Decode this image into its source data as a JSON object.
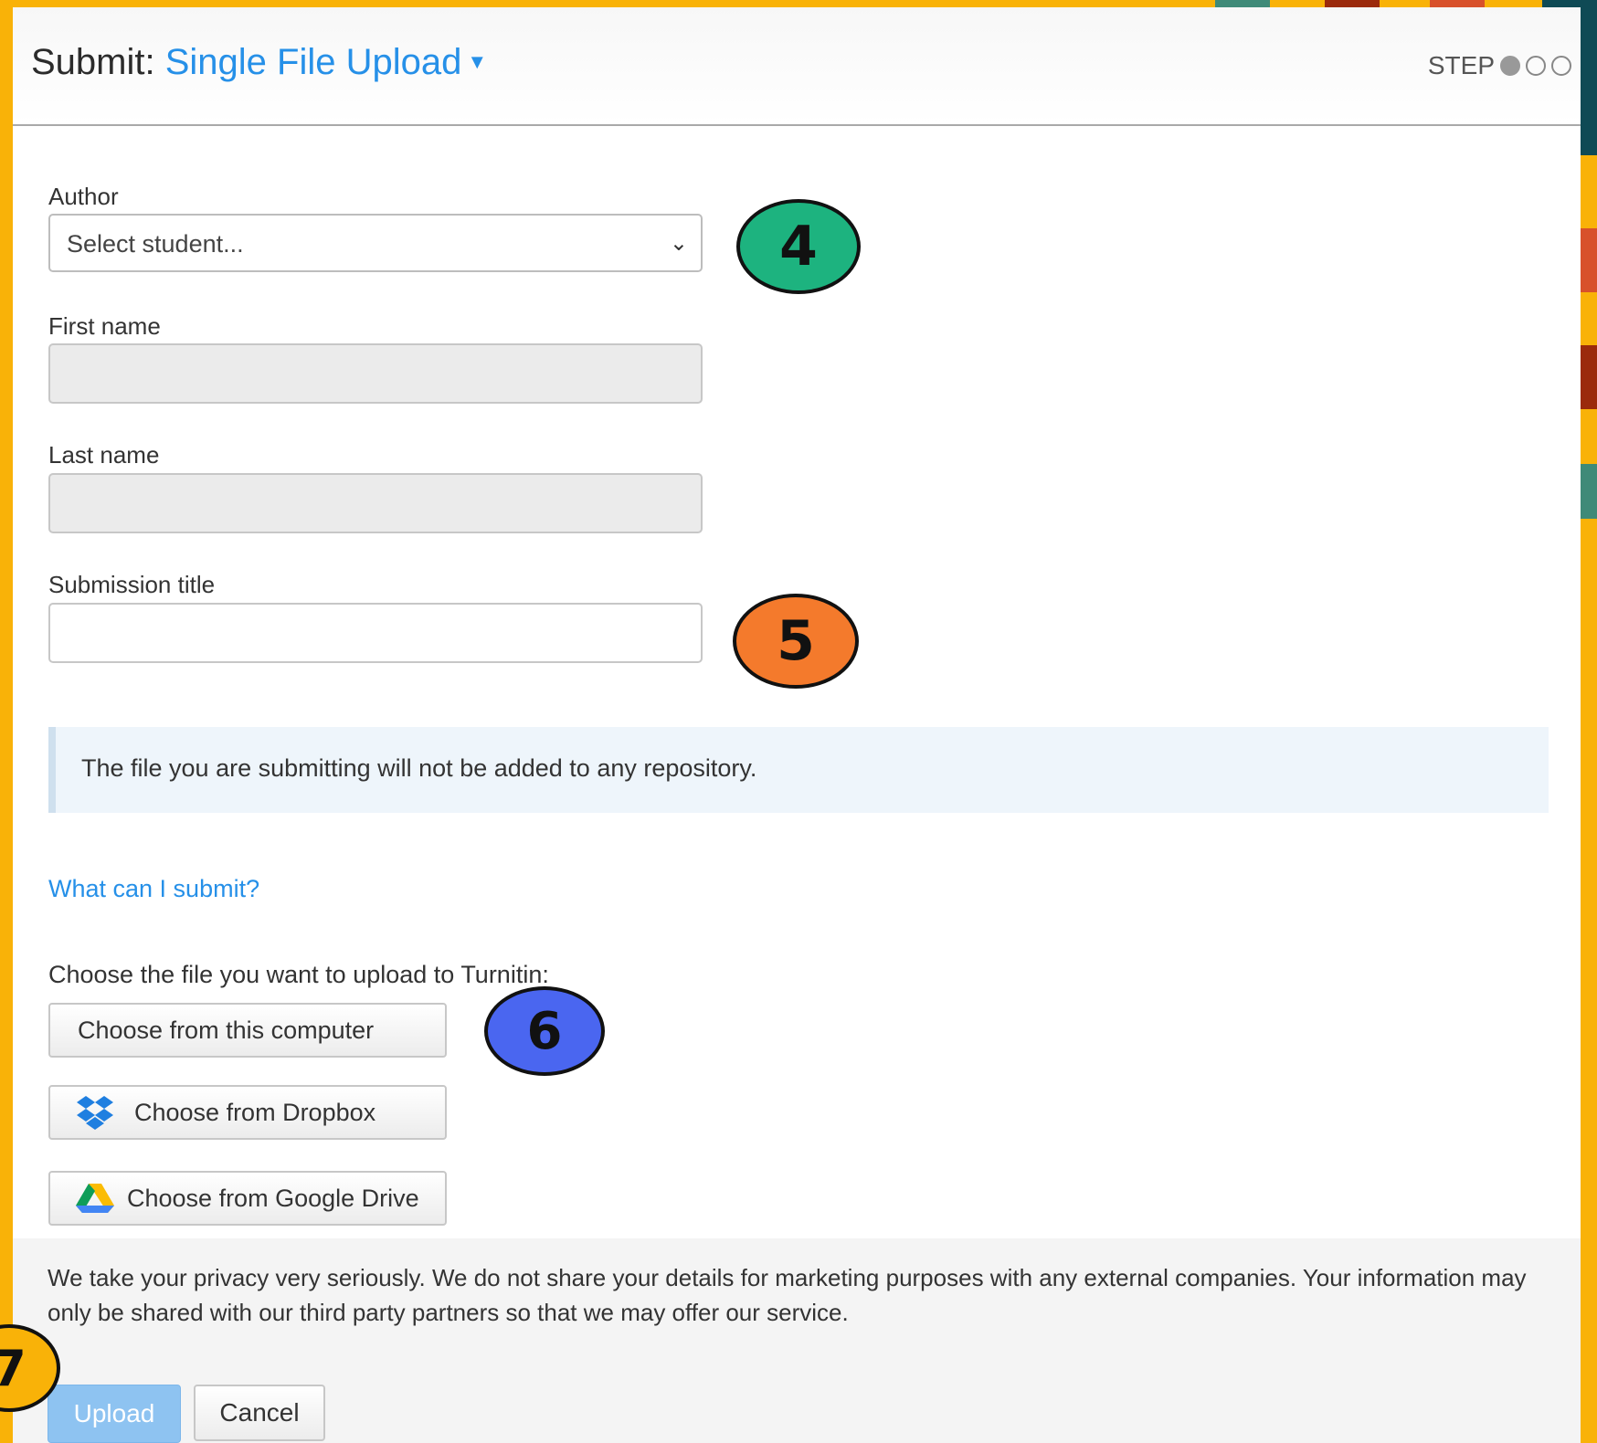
{
  "header": {
    "title_prefix": "Submit:",
    "title_dropdown": "Single File Upload",
    "step_label": "STEP"
  },
  "form": {
    "author_label": "Author",
    "author_select_value": "Select student...",
    "first_name_label": "First name",
    "last_name_label": "Last name",
    "submission_title_label": "Submission title"
  },
  "info_message": "The file you are submitting will not be added to any repository.",
  "what_can_i_submit_link": "What can I submit?",
  "choose_file_label": "Choose the file you want to upload to Turnitin:",
  "buttons": {
    "choose_computer": "Choose from this computer",
    "choose_dropbox": "Choose from Dropbox",
    "choose_drive": "Choose from Google Drive",
    "upload": "Upload",
    "cancel": "Cancel"
  },
  "privacy_text": "We take your privacy very seriously. We do not share your details for marketing purposes with any external companies. Your information may only be shared with our third party partners so that we may offer our service.",
  "annotations": {
    "step_4": "4",
    "step_5": "5",
    "step_6": "6",
    "step_7": "7"
  },
  "colors": {
    "accent": "#2690e8",
    "background": "#F9B208",
    "badge_4": "#1db37f",
    "badge_5": "#f47a2c",
    "badge_6": "#4a66f0"
  }
}
